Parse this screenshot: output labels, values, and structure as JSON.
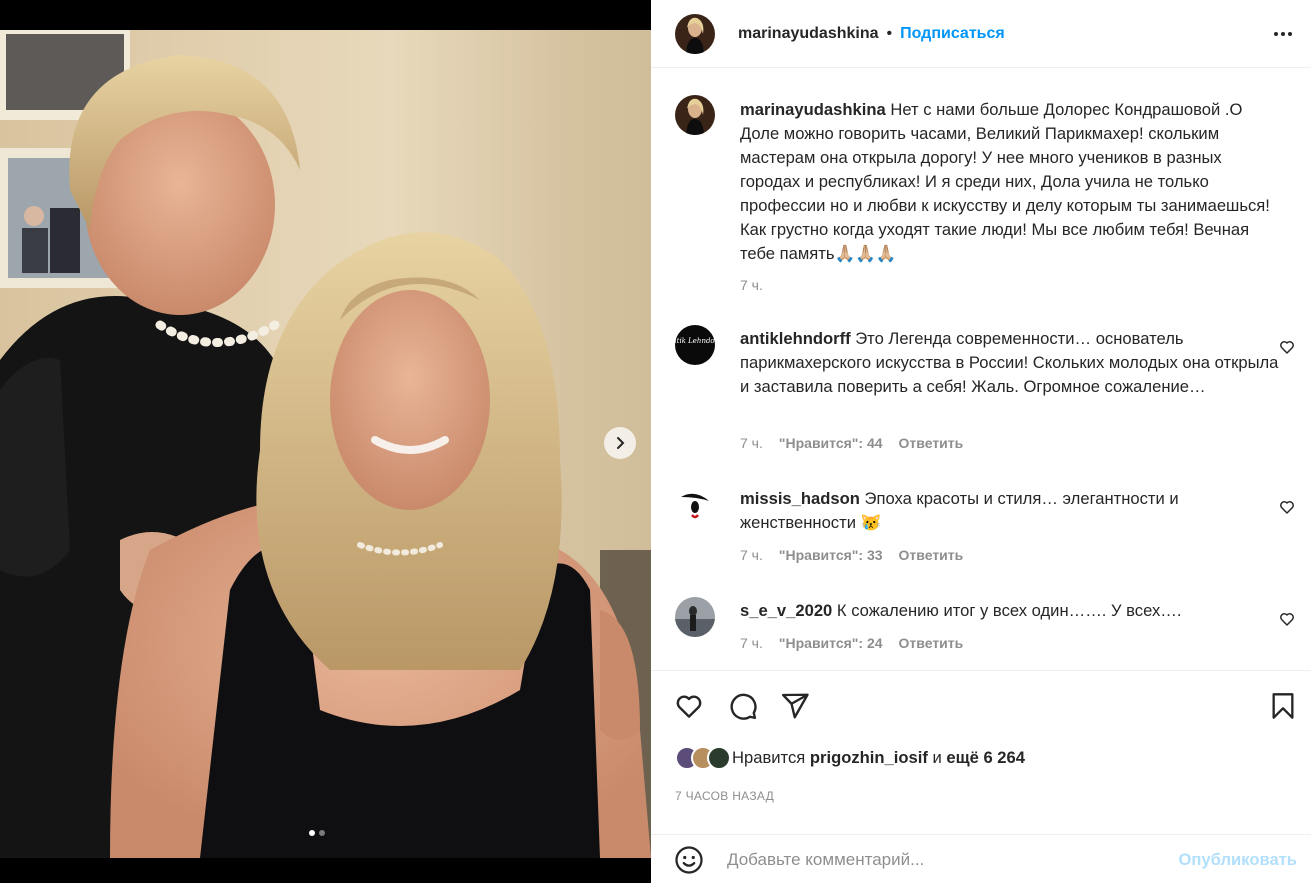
{
  "post": {
    "author": "marinayudashkina",
    "separator": "•",
    "follow_label": "Подписаться",
    "caption_text": "Нет с нами больше Долорес Кондрашовой .О Доле можно говорить часами, Великий Парикмахер! скольким мастерам она открыла дорогу! У нее много учеников в разных городах и республиках! И я среди них, Дола учила не только профессии но и любви к искусству и делу которым ты занимаешься! Как грустно когда уходят такие люди! Мы все любим тебя! Вечная тебе память🙏🏼🙏🏼🙏🏼",
    "caption_time": "7 ч.",
    "carousel": {
      "slides": 2,
      "active": 1
    }
  },
  "comments": [
    {
      "username": "antiklehndorff",
      "avatar_text": "Antik Lehndorff",
      "text": "Это Легенда современности… основатель парикмахерского искусства в России! Скольких молодых она открыла и заставила поверить а себя! Жаль. Огромное сожаление…",
      "time": "7 ч.",
      "likes": "\"Нравится\": 44",
      "reply": "Ответить"
    },
    {
      "username": "missis_hadson",
      "text": "Эпоха красоты и стиля… элегантности и женственности 😿",
      "time": "7 ч.",
      "likes": "\"Нравится\": 33",
      "reply": "Ответить"
    },
    {
      "username": "s_e_v_2020",
      "text": "К сожалению итог у всех один……. У всех….",
      "time": "7 ч.",
      "likes": "\"Нравится\": 24",
      "reply": "Ответить"
    }
  ],
  "likes_summary": {
    "prefix": "Нравится",
    "user": "prigozhin_iosif",
    "conj": "и",
    "rest": "ещё 6 264"
  },
  "posted_ago": "7 ЧАСОВ НАЗАД",
  "composer": {
    "placeholder": "Добавьте комментарий...",
    "publish_label": "Опубликовать"
  },
  "colors": {
    "accent": "#0095f6",
    "muted": "#8e8e8e",
    "publish_disabled": "#b2dffc"
  },
  "icons": [
    "chevron-right-icon",
    "more-icon",
    "heart-icon",
    "comment-icon",
    "share-icon",
    "bookmark-icon",
    "emoji-icon"
  ]
}
